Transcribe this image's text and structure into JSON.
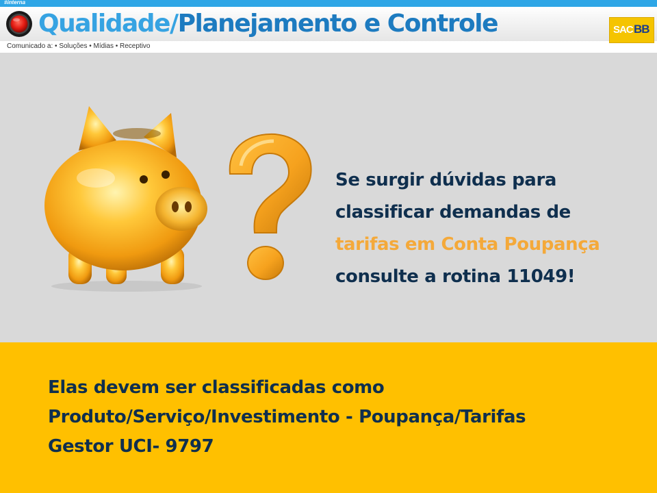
{
  "header": {
    "tag": "#interna",
    "title_part1": "Qualidade/",
    "title_part2": "Planejamento e Controle",
    "subtitle": "Comunicado a: • Soluções • Mídias • Receptivo",
    "logo_left": "SAC",
    "logo_right": "BB",
    "accent_color": "#2ea6e6"
  },
  "message": {
    "line1": "Se surgir dúvidas para",
    "line2": "classificar demandas de",
    "line3_highlight": "tarifas em Conta Poupança",
    "line4": "consulte a rotina 11049!",
    "highlight_color": "#f4a93a"
  },
  "footer": {
    "line1": "Elas devem ser classificadas como",
    "line2": "Produto/Serviço/Investimento - Poupança/Tarifas",
    "line3": "Gestor UCI- 9797",
    "background_color": "#ffc000"
  },
  "icons": {
    "record": "record-icon",
    "illustration": "piggy-bank-icon",
    "question": "question-mark-icon"
  }
}
